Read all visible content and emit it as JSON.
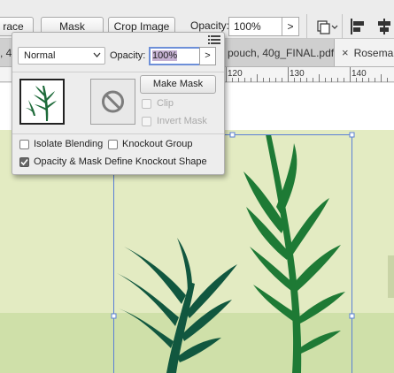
{
  "control_bar": {
    "trace_label": "race",
    "mask_label": "Mask",
    "crop_label": "Crop Image",
    "opacity_label": "Opacity:",
    "opacity_value": "100%",
    "opacity_arrow": ">"
  },
  "tabs": [
    {
      "label": ", 4"
    },
    {
      "label": "pouch, 40g_FINAL.pdf"
    },
    {
      "label": "Rosemar",
      "close": "×"
    }
  ],
  "ruler": {
    "ticks": [
      "120",
      "130",
      "140"
    ]
  },
  "effects_panel": {
    "blend_mode": "Normal",
    "opacity_label": "Opacity:",
    "opacity_value": "100%",
    "opacity_arrow": ">",
    "make_mask_label": "Make Mask",
    "clip_label": "Clip",
    "invert_mask_label": "Invert Mask",
    "isolate_blending_label": "Isolate Blending",
    "knockout_group_label": "Knockout Group",
    "opacity_mask_knockout_label": "Opacity & Mask Define Knockout Shape",
    "isolate_blending_checked": false,
    "knockout_group_checked": false,
    "opacity_mask_knockout_checked": true
  },
  "colors": {
    "artwork_light": "#e3ebc2",
    "artwork_band": "#cfe0a9",
    "leaf_dark": "#11573f",
    "leaf_green": "#1e7a35",
    "selection": "#5a7fd6"
  }
}
